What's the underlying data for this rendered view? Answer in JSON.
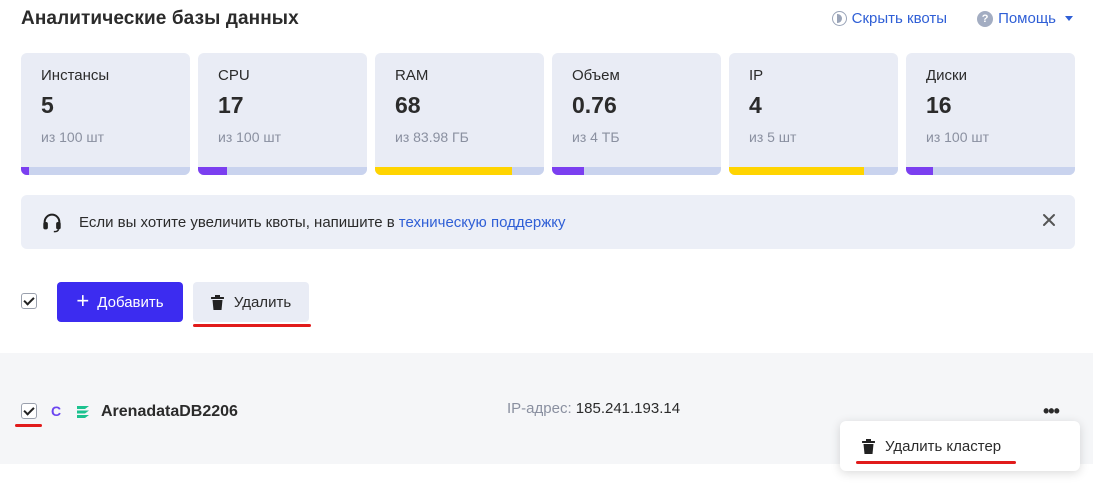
{
  "header": {
    "title": "Аналитические базы данных",
    "hide_quotas_label": "Скрыть квоты",
    "help_label": "Помощь"
  },
  "quotas": [
    {
      "label": "Инстансы",
      "value": "5",
      "sub": "из 100 шт",
      "fill_fraction": 0.05,
      "fill_color": "#7b3ff0"
    },
    {
      "label": "CPU",
      "value": "17",
      "sub": "из 100 шт",
      "fill_fraction": 0.17,
      "fill_color": "#7b3ff0"
    },
    {
      "label": "RAM",
      "value": "68",
      "sub": "из 83.98 ГБ",
      "fill_fraction": 0.81,
      "fill_color": "#ffd400"
    },
    {
      "label": "Объем",
      "value": "0.76",
      "sub": "из 4 ТБ",
      "fill_fraction": 0.19,
      "fill_color": "#7b3ff0"
    },
    {
      "label": "IP",
      "value": "4",
      "sub": "из 5 шт",
      "fill_fraction": 0.8,
      "fill_color": "#ffd400"
    },
    {
      "label": "Диски",
      "value": "16",
      "sub": "из 100 шт",
      "fill_fraction": 0.16,
      "fill_color": "#7b3ff0"
    }
  ],
  "banner": {
    "text": "Если вы хотите увеличить квоты, напишите в",
    "link": "техническую поддержку"
  },
  "toolbar": {
    "add_label": "Добавить",
    "delete_label": "Удалить"
  },
  "cluster": {
    "badge": "C",
    "name": "ArenadataDB2206",
    "ip_label": "IP-адрес:",
    "ip_value": "185.241.193.14",
    "menu_dots": "•••"
  },
  "context_menu": {
    "delete_cluster_label": "Удалить кластер"
  },
  "colors": {
    "accent": "#3c2cf0",
    "link": "#2f5fd6",
    "annotation_red": "#e11b1b"
  }
}
